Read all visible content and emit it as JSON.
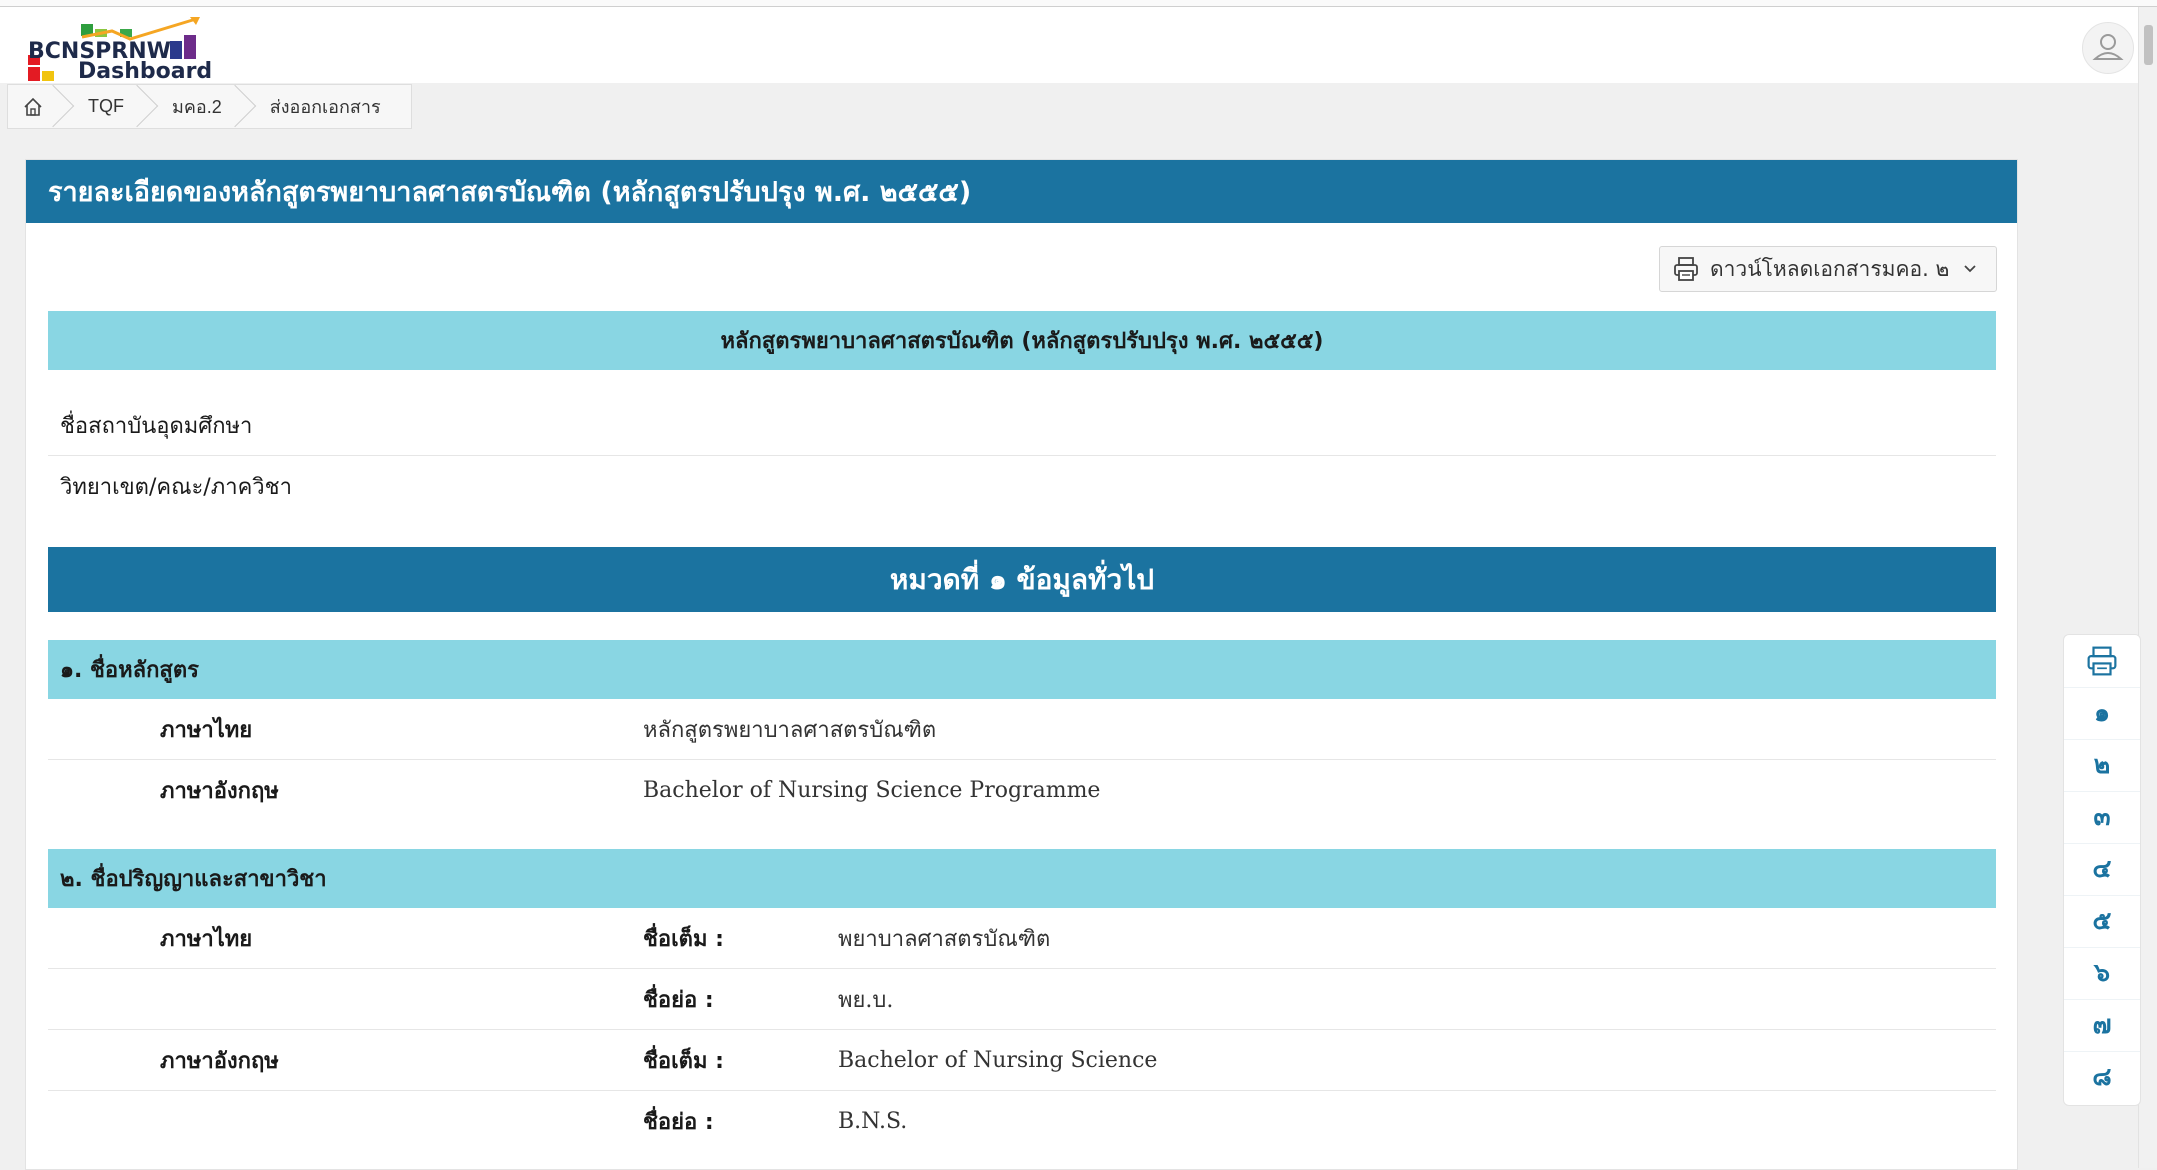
{
  "header": {
    "logo_line1": "BCNSPRNW",
    "logo_line2": "Dashboard",
    "avatar_icon": "user-icon"
  },
  "breadcrumb": {
    "home_icon": "home-icon",
    "items": [
      "TQF",
      "มคอ.2",
      "ส่งออกเอกสาร"
    ]
  },
  "card": {
    "title": "รายละเอียดของหลักสูตรพยาบาลศาสตรบัณฑิต  (หลักสูตรปรับปรุง  พ.ศ. ๒๕๕๕)",
    "download_button": "ดาวน์โหลดเอกสารมคอ. ๒",
    "program_band": "หลักสูตรพยาบาลศาสตรบัณฑิต (หลักสูตรปรับปรุง  พ.ศ. ๒๕๕๕)",
    "institution_label": "ชื่อสถาบันอุดมศึกษา",
    "faculty_label": "วิทยาเขต/คณะ/ภาควิชา"
  },
  "section1": {
    "title": "หมวดที่ ๑ ข้อมูลทั่วไป",
    "topic1": {
      "heading": "๑. ชื่อหลักสูตร",
      "rows": [
        {
          "label": "ภาษาไทย",
          "value": "หลักสูตรพยาบาลศาสตรบัณฑิต"
        },
        {
          "label": "ภาษาอังกฤษ",
          "value": "Bachelor of Nursing Science Programme"
        }
      ]
    },
    "topic2": {
      "heading": "๒. ชื่อปริญญาและสาขาวิชา",
      "rows": [
        {
          "label": "ภาษาไทย",
          "field": "ชื่อเต็ม :",
          "value": "พยาบาลศาสตรบัณฑิต"
        },
        {
          "label": "",
          "field": "ชื่อย่อ :",
          "value": "พย.บ."
        },
        {
          "label": "ภาษาอังกฤษ",
          "field": "ชื่อเต็ม :",
          "value": "Bachelor of Nursing Science"
        },
        {
          "label": "",
          "field": "ชื่อย่อ :",
          "value": "B.N.S."
        }
      ]
    }
  },
  "sidenav": {
    "print_icon": "printer-icon",
    "items": [
      "๑",
      "๒",
      "๓",
      "๔",
      "๕",
      "๖",
      "๗",
      "๘"
    ]
  },
  "colors": {
    "primary": "#1b73a0",
    "band_light": "#89d6e3"
  }
}
